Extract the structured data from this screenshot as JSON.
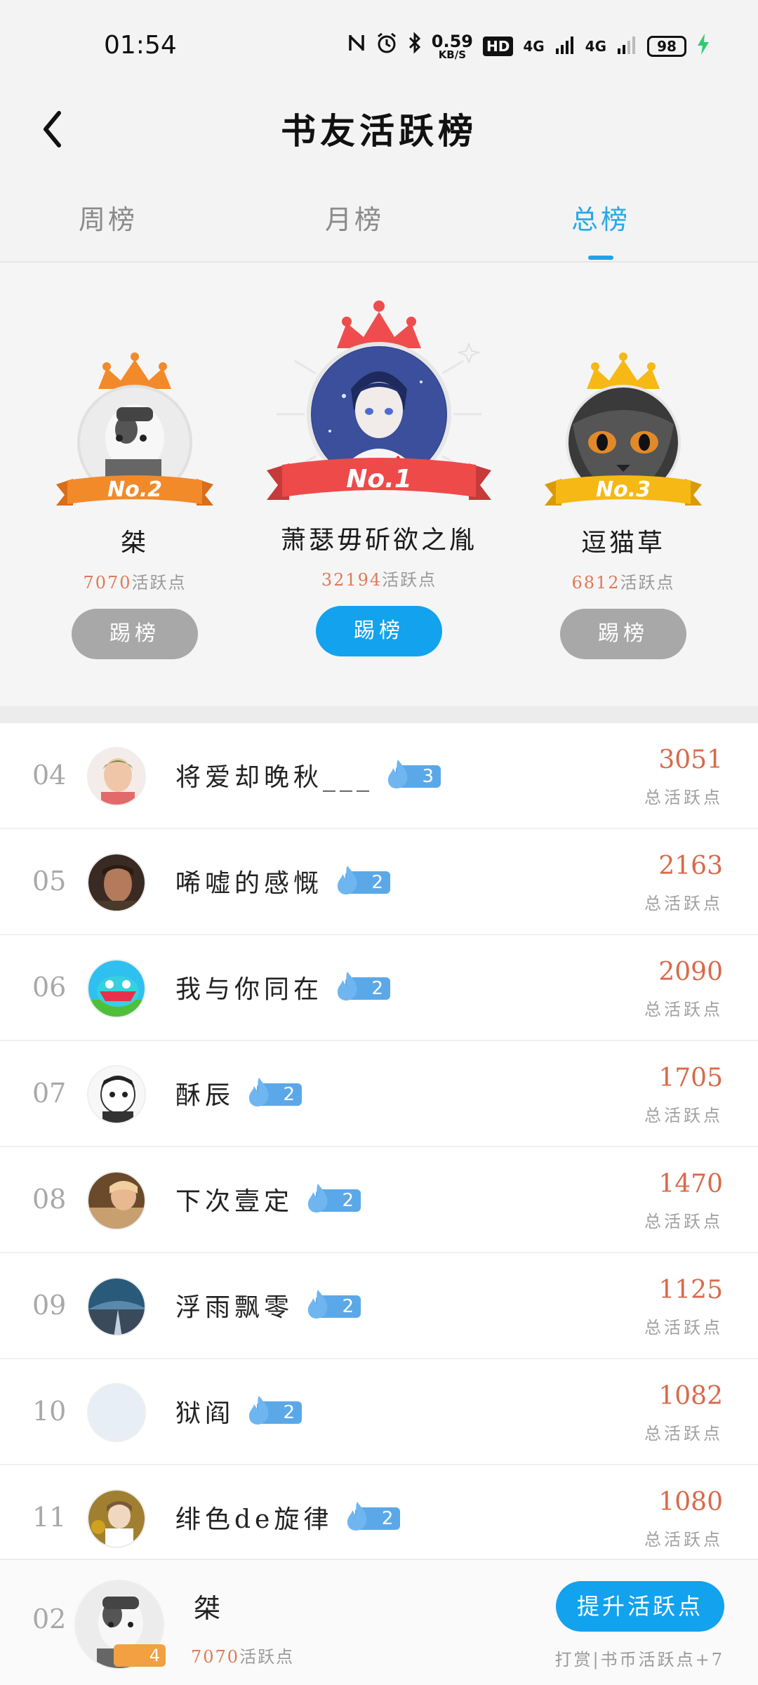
{
  "status_bar": {
    "time": "01:54",
    "speed_value": "0.59",
    "speed_unit": "KB/S",
    "hd": "HD",
    "net1": "4G",
    "net2": "4G",
    "battery": "98",
    "icons": [
      "nfc-icon",
      "alarm-icon",
      "bluetooth-icon",
      "signal-icon",
      "charging-icon"
    ]
  },
  "header": {
    "title": "书友活跃榜",
    "back_icon": "chevron-left-icon"
  },
  "tabs": [
    {
      "label": "周榜",
      "active": false
    },
    {
      "label": "月榜",
      "active": false
    },
    {
      "label": "总榜",
      "active": true
    }
  ],
  "podium": [
    {
      "rank": "No.2",
      "name": "桀",
      "points": "7070",
      "points_label": "活跃点",
      "button": "踢榜",
      "crown_color": "#f28a2a",
      "ribbon_color": "#f28a2a"
    },
    {
      "rank": "No.1",
      "name": "萧瑟毋斫欲之胤",
      "points": "32194",
      "points_label": "活跃点",
      "button": "踢榜",
      "crown_color": "#ef4d4d",
      "ribbon_color": "#ee4a4a"
    },
    {
      "rank": "No.3",
      "name": "逗猫草",
      "points": "6812",
      "points_label": "活跃点",
      "button": "踢榜",
      "crown_color": "#f6b814",
      "ribbon_color": "#f6b814"
    }
  ],
  "ranking": [
    {
      "no": "04",
      "name": "将爱却晚秋___",
      "level": "3",
      "score": "3051",
      "score_label": "总活跃点"
    },
    {
      "no": "05",
      "name": "唏嘘的感慨",
      "level": "2",
      "score": "2163",
      "score_label": "总活跃点"
    },
    {
      "no": "06",
      "name": "我与你同在",
      "level": "2",
      "score": "2090",
      "score_label": "总活跃点"
    },
    {
      "no": "07",
      "name": "酥辰",
      "level": "2",
      "score": "1705",
      "score_label": "总活跃点"
    },
    {
      "no": "08",
      "name": "下次壹定",
      "level": "2",
      "score": "1470",
      "score_label": "总活跃点"
    },
    {
      "no": "09",
      "name": "浮雨飘零",
      "level": "2",
      "score": "1125",
      "score_label": "总活跃点"
    },
    {
      "no": "10",
      "name": "狱阎",
      "level": "2",
      "score": "1082",
      "score_label": "总活跃点"
    },
    {
      "no": "11",
      "name": "绯色de旋律",
      "level": "2",
      "score": "1080",
      "score_label": "总活跃点"
    }
  ],
  "me": {
    "rank": "02",
    "name": "桀",
    "level": "4",
    "points": "7070",
    "points_label": "活跃点",
    "button": "提升活跃点",
    "tip": "打赏|书币活跃点+7"
  }
}
